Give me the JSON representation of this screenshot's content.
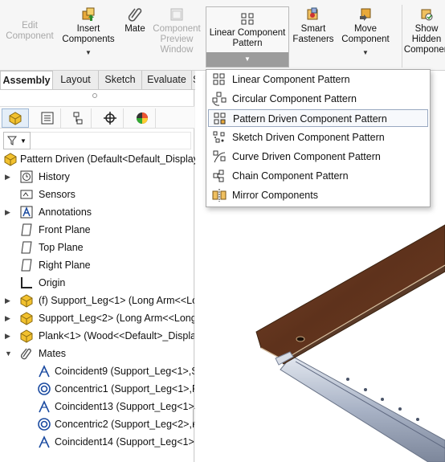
{
  "ribbon": {
    "edit_component": "Edit\nComponent",
    "insert_components": "Insert\nComponents",
    "mate": "Mate",
    "component_preview_window": "Component\nPreview\nWindow",
    "linear_component_pattern": "Linear Component\nPattern",
    "smart_fasteners": "Smart\nFasteners",
    "move_component": "Move\nComponent",
    "show_hidden_components": "Show\nHidden\nComponen"
  },
  "tabs": [
    "Assembly",
    "Layout",
    "Sketch",
    "Evaluate",
    "SO"
  ],
  "dropdown": {
    "items": [
      "Linear Component Pattern",
      "Circular Component Pattern",
      "Pattern Driven Component Pattern",
      "Sketch Driven Component Pattern",
      "Curve Driven Component Pattern",
      "Chain Component Pattern",
      "Mirror Components"
    ],
    "highlighted_index": 2
  },
  "tree": {
    "root": "Pattern Driven  (Default<Default_Display",
    "items": [
      "History",
      "Sensors",
      "Annotations",
      "Front Plane",
      "Top Plane",
      "Right Plane",
      "Origin",
      "(f) Support_Leg<1> (Long Arm<<Lo",
      "Support_Leg<2> (Long Arm<<Long",
      "Plank<1> (Wood<<Default>_Displa",
      "Mates"
    ],
    "mates": [
      "Coincident9 (Support_Leg<1>,S",
      "Concentric1 (Support_Leg<1>,P",
      "Coincident13 (Support_Leg<1>,",
      "Concentric2 (Support_Leg<2>,P",
      "Coincident14 (Support_Leg<1>,"
    ]
  },
  "colors": {
    "plank": "#6b3a22",
    "rail": "#aab4c8",
    "assembly_icon": "#f2c12e"
  }
}
